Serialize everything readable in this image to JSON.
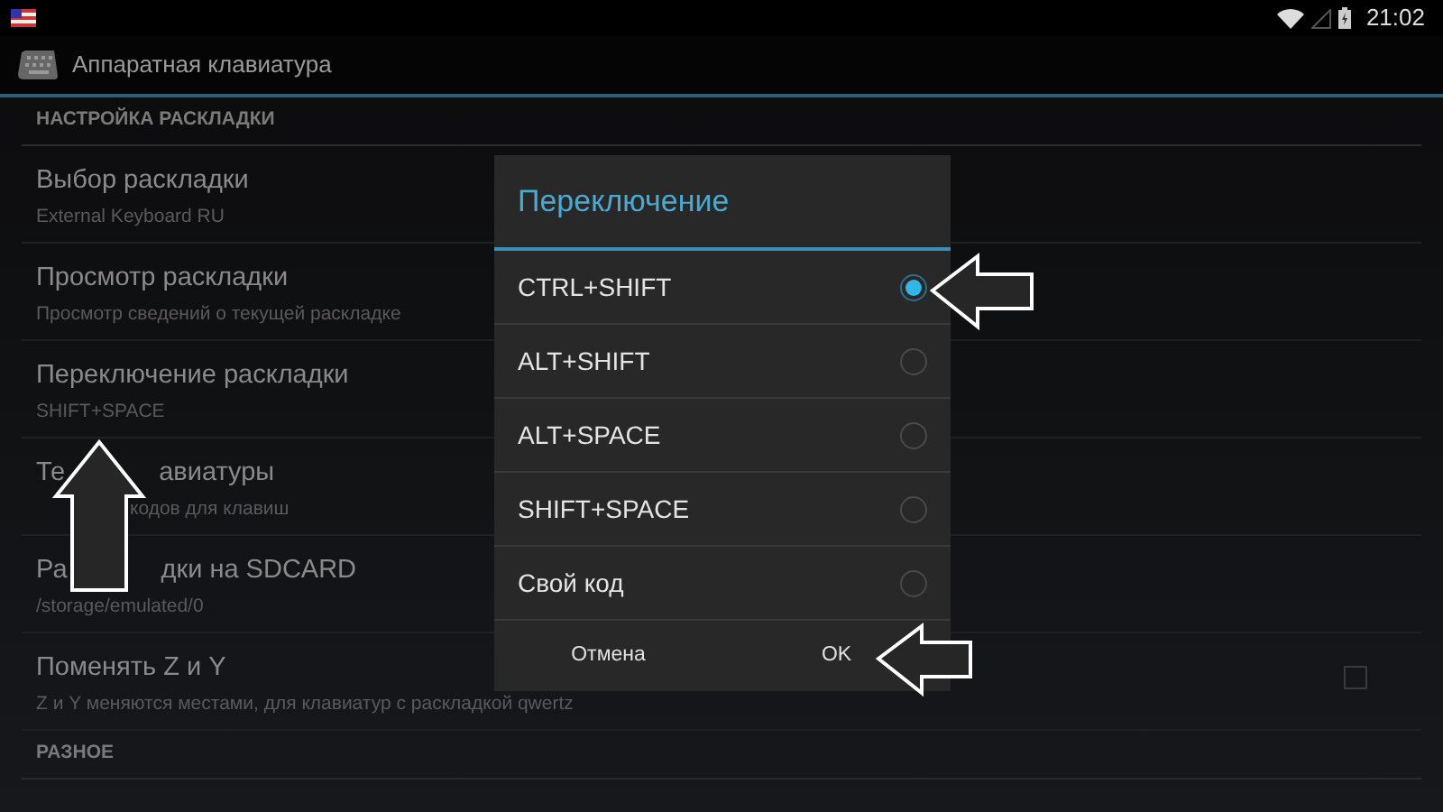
{
  "status_bar": {
    "time": "21:02"
  },
  "action_bar": {
    "title": "Аппаратная клавиатура"
  },
  "sections": [
    {
      "header": "НАСТРОЙКА РАСКЛАДКИ",
      "items": [
        {
          "kind": "text",
          "title": "Выбор раскладки",
          "summary": "External Keyboard RU"
        },
        {
          "kind": "text",
          "title": "Просмотр раскладки",
          "summary": "Просмотр сведений о текущей раскладке"
        },
        {
          "kind": "text",
          "title": "Переключение раскладки",
          "summary": "SHIFT+SPACE"
        },
        {
          "kind": "text",
          "title_start": "Те",
          "title_end": "авиатуры",
          "summary_end": "кодов для клавиш"
        },
        {
          "kind": "text",
          "title_start": "Ра",
          "title_end": "дки на SDCARD",
          "summary": "/storage/emulated/0"
        },
        {
          "kind": "checkbox",
          "title": "Поменять Z и Y",
          "summary": "Z и Y меняются местами, для клавиатур с раскладкой qwertz",
          "checked": false
        }
      ]
    },
    {
      "header": "РАЗНОЕ"
    }
  ],
  "dialog": {
    "title": "Переключение",
    "options": [
      {
        "label": "CTRL+SHIFT",
        "selected": true
      },
      {
        "label": "ALT+SHIFT",
        "selected": false
      },
      {
        "label": "ALT+SPACE",
        "selected": false
      },
      {
        "label": "SHIFT+SPACE",
        "selected": false
      },
      {
        "label": "Свой код",
        "selected": false
      }
    ],
    "buttons": [
      "Отмена",
      "OK"
    ]
  }
}
